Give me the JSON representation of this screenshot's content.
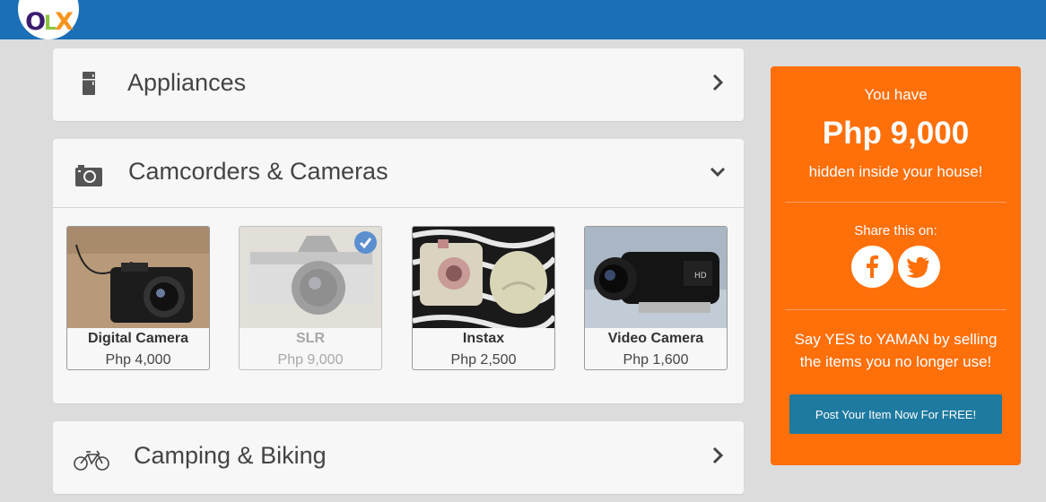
{
  "header": {
    "logo": {
      "o": "O",
      "l": "L",
      "x": "X"
    }
  },
  "categories": [
    {
      "label": "Appliances",
      "icon": "fridge-icon",
      "expanded": false
    },
    {
      "label": "Camcorders & Cameras",
      "icon": "camera-icon",
      "expanded": true
    },
    {
      "label": "Camping & Biking",
      "icon": "bicycle-icon",
      "expanded": false
    }
  ],
  "items": [
    {
      "name": "Digital Camera",
      "price": "Php 4,000",
      "selected": false
    },
    {
      "name": "SLR",
      "price": "Php 9,000",
      "selected": true
    },
    {
      "name": "Instax",
      "price": "Php 2,500",
      "selected": false
    },
    {
      "name": "Video Camera",
      "price": "Php 1,600",
      "selected": false
    }
  ],
  "promo": {
    "line1": "You have",
    "amount": "Php 9,000",
    "line2": "hidden inside your house!",
    "share_label": "Share this on:",
    "social": [
      "facebook-icon",
      "twitter-icon"
    ],
    "line3a": "Say YES to YAMAN by selling",
    "line3b": "the items you no longer use!",
    "cta": "Post Your Item Now For FREE!"
  },
  "colors": {
    "topbar": "#1a6fb6",
    "promo_bg": "#ff6f0a",
    "cta_bg": "#1e7aa0",
    "check": "#5b8fcf"
  }
}
